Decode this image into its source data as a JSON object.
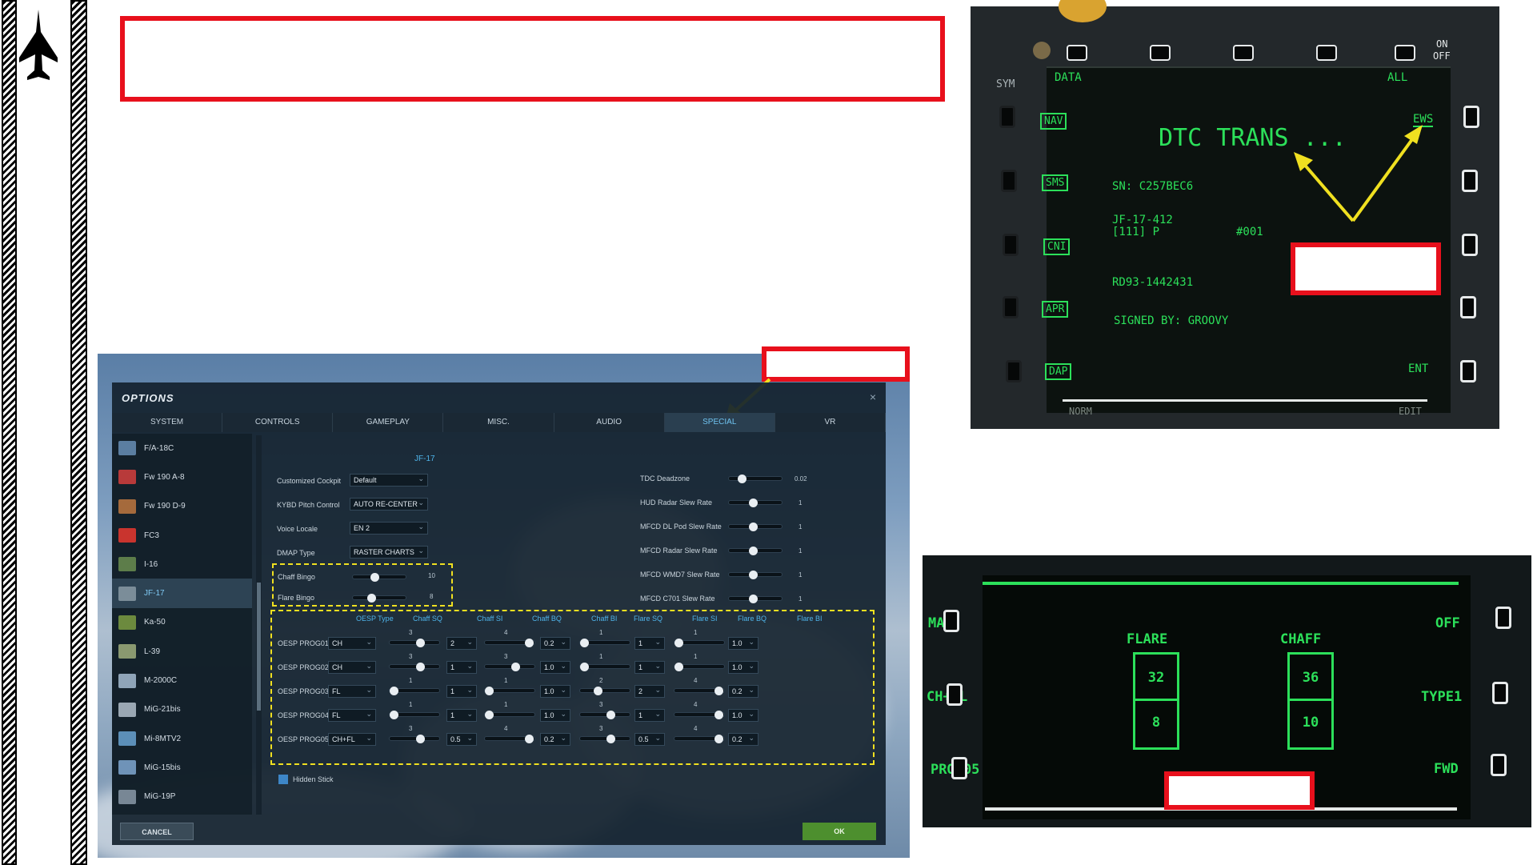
{
  "options": {
    "title": "OPTIONS",
    "close_glyph": "×",
    "tabs": [
      "SYSTEM",
      "CONTROLS",
      "GAMEPLAY",
      "MISC.",
      "AUDIO",
      "SPECIAL",
      "VR"
    ],
    "active_tab": "SPECIAL",
    "aircraft": [
      "F/A-18C",
      "Fw 190 A-8",
      "Fw 190 D-9",
      "FC3",
      "I-16",
      "JF-17",
      "Ka-50",
      "L-39",
      "M-2000C",
      "MiG-21bis",
      "Mi-8MTV2",
      "MiG-15bis",
      "MiG-19P"
    ],
    "selected_aircraft": "JF-17",
    "section_title": "JF-17",
    "left_settings": [
      {
        "label": "Customized Cockpit",
        "value": "Default"
      },
      {
        "label": "KYBD Pitch Control",
        "value": "AUTO RE-CENTER"
      },
      {
        "label": "Voice Locale",
        "value": "EN 2"
      },
      {
        "label": "DMAP Type",
        "value": "RASTER CHARTS"
      }
    ],
    "bingo": [
      {
        "label": "Chaff Bingo",
        "value": "10",
        "level": 0.4
      },
      {
        "label": "Flare Bingo",
        "value": "8",
        "level": 0.32
      }
    ],
    "right_settings": [
      {
        "label": "TDC Deadzone",
        "value": "0.02",
        "level": 0.2
      },
      {
        "label": "HUD Radar Slew Rate",
        "value": "1",
        "level": 0.45
      },
      {
        "label": "MFCD DL Pod Slew Rate",
        "value": "1",
        "level": 0.45
      },
      {
        "label": "MFCD Radar Slew Rate",
        "value": "1",
        "level": 0.45
      },
      {
        "label": "MFCD WMD7 Slew Rate",
        "value": "1",
        "level": 0.45
      },
      {
        "label": "MFCD C701 Slew Rate",
        "value": "1",
        "level": 0.45
      }
    ],
    "oesp_headers": [
      "OESP Type",
      "Chaff SQ",
      "Chaff SI",
      "Chaff BQ",
      "Chaff BI",
      "Flare SQ",
      "Flare SI",
      "Flare BQ",
      "Flare BI"
    ],
    "oesp_rows": [
      {
        "name": "OESP PROG01",
        "type": "CH",
        "chaff_sq": "3",
        "chaff_sq_level": 0.65,
        "chaff_si": "2",
        "chaff_bq": "4",
        "chaff_bq_level": 0.98,
        "chaff_bi": "0.2",
        "flare_sq": "1",
        "flare_sq_level": 0.0,
        "flare_si": "1",
        "flare_bq": "1",
        "flare_bq_level": 0.0,
        "flare_bi": "1.0"
      },
      {
        "name": "OESP PROG02",
        "type": "CH",
        "chaff_sq": "3",
        "chaff_sq_level": 0.65,
        "chaff_si": "1",
        "chaff_bq": "3",
        "chaff_bq_level": 0.65,
        "chaff_bi": "1.0",
        "flare_sq": "1",
        "flare_sq_level": 0.0,
        "flare_si": "1",
        "flare_bq": "1",
        "flare_bq_level": 0.0,
        "flare_bi": "1.0"
      },
      {
        "name": "OESP PROG03",
        "type": "FL",
        "chaff_sq": "1",
        "chaff_sq_level": 0.0,
        "chaff_si": "1",
        "chaff_bq": "1",
        "chaff_bq_level": 0.0,
        "chaff_bi": "1.0",
        "flare_sq": "2",
        "flare_sq_level": 0.33,
        "flare_si": "2",
        "flare_bq": "4",
        "flare_bq_level": 0.98,
        "flare_bi": "0.2"
      },
      {
        "name": "OESP PROG04",
        "type": "FL",
        "chaff_sq": "1",
        "chaff_sq_level": 0.0,
        "chaff_si": "1",
        "chaff_bq": "1",
        "chaff_bq_level": 0.0,
        "chaff_bi": "1.0",
        "flare_sq": "3",
        "flare_sq_level": 0.65,
        "flare_si": "1",
        "flare_bq": "4",
        "flare_bq_level": 0.98,
        "flare_bi": "1.0"
      },
      {
        "name": "OESP PROG05",
        "type": "CH+FL",
        "chaff_sq": "3",
        "chaff_sq_level": 0.65,
        "chaff_si": "0.5",
        "chaff_bq": "4",
        "chaff_bq_level": 0.98,
        "chaff_bi": "0.2",
        "flare_sq": "3",
        "flare_sq_level": 0.65,
        "flare_si": "0.5",
        "flare_bq": "4",
        "flare_bq_level": 0.98,
        "flare_bi": "0.2"
      }
    ],
    "hidden_stick_label": "Hidden Stick",
    "cancel_label": "CANCEL",
    "ok_label": "OK"
  },
  "mfd_dtc": {
    "top_left": "SYM",
    "data_label": "DATA",
    "all_label": "ALL",
    "on_label": "ON",
    "off_label": "OFF",
    "left_menu": [
      "NAV",
      "SMS",
      "CNI",
      "APR",
      "DAP"
    ],
    "right_menu": [
      "EWS",
      "ENT"
    ],
    "headline": "DTC TRANS ...",
    "serial": "SN: C257BEC6",
    "config_line1": "JF-17-412",
    "config_line2": "[111] P",
    "config_id": "#001",
    "rd_code": "RD93-1442431",
    "signed_by": "SIGNED BY: GROOVY",
    "bottom_left": "NORM",
    "bottom_right": "EDIT"
  },
  "mfd_ews": {
    "left_labels": [
      "MAN",
      "CH+FL",
      "PROG05"
    ],
    "right_labels": [
      "OFF",
      "TYPE1",
      "FWD"
    ],
    "flare_label": "FLARE",
    "chaff_label": "CHAFF",
    "flare_count": "32",
    "flare_bingo": "8",
    "chaff_count": "36",
    "chaff_bingo": "10"
  },
  "colors": {
    "callout_red": "#e8101c",
    "highlight_yellow": "#f0e020",
    "mfd_green": "#2ce05a",
    "accent_blue": "#4fb4ea"
  }
}
